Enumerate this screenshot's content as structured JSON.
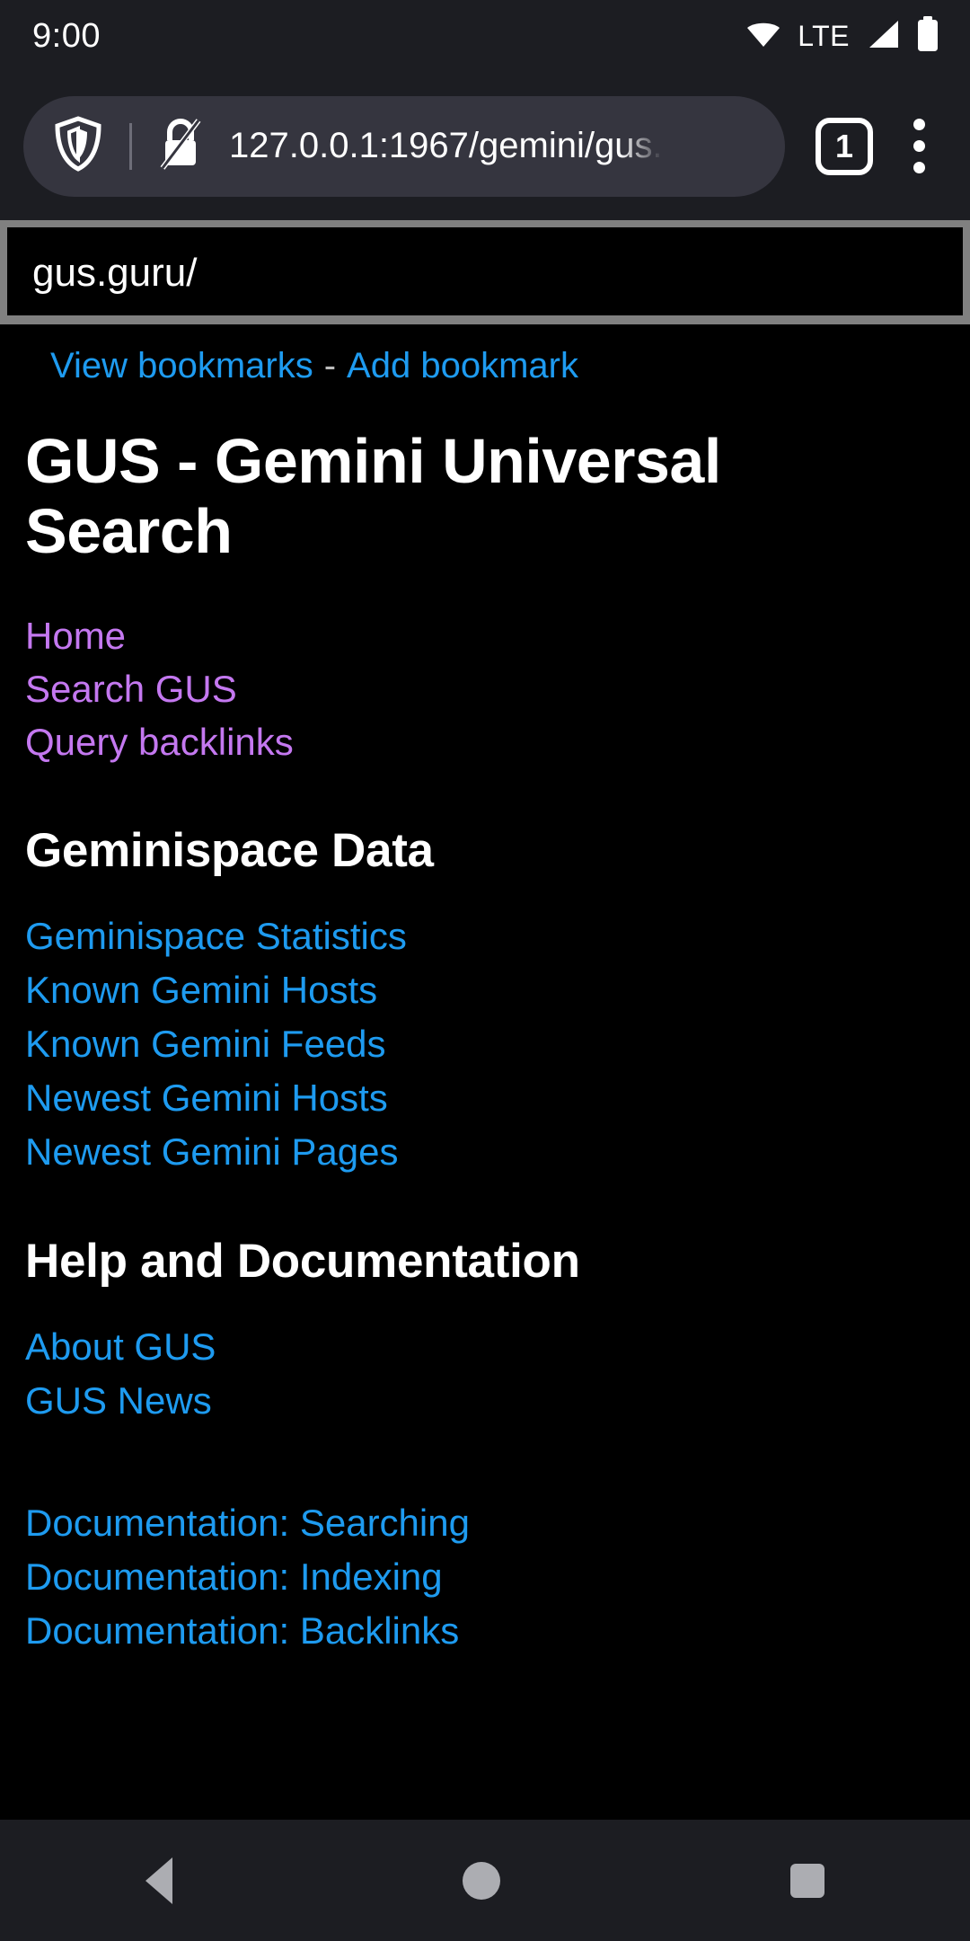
{
  "statusbar": {
    "clock": "9:00",
    "network_label": "LTE",
    "icons": [
      "wifi-icon",
      "lte-label",
      "cellular-signal-icon",
      "battery-icon"
    ]
  },
  "toolbar": {
    "shield_icon": "brave-shield-icon",
    "security_icon": "insecure-connection-icon",
    "url": "127.0.0.1:1967/gemini/gus.",
    "tab_count": "1",
    "menu_icon": "three-dot-menu-icon"
  },
  "addressbar": {
    "value": "gus.guru/",
    "placeholder": "gus.guru/"
  },
  "bookmarks": {
    "view_label": "View bookmarks",
    "separator": "-",
    "add_label": "Add bookmark"
  },
  "page": {
    "title": "GUS - Gemini Universal Search",
    "nav_links": [
      {
        "label": "Home"
      },
      {
        "label": "Search GUS"
      },
      {
        "label": "Query backlinks"
      }
    ],
    "sections": [
      {
        "heading": "Geminispace Data",
        "links": [
          {
            "label": "Geminispace Statistics"
          },
          {
            "label": "Known Gemini Hosts"
          },
          {
            "label": "Known Gemini Feeds"
          },
          {
            "label": "Newest Gemini Hosts"
          },
          {
            "label": "Newest Gemini Pages"
          }
        ]
      },
      {
        "heading": "Help and Documentation",
        "links": [
          {
            "label": "About GUS"
          },
          {
            "label": "GUS News"
          }
        ],
        "links2": [
          {
            "label": "Documentation: Searching"
          },
          {
            "label": "Documentation: Indexing"
          },
          {
            "label": "Documentation: Backlinks"
          }
        ]
      }
    ]
  },
  "navbar": {
    "back": "back-button",
    "home": "home-button",
    "recents": "recents-button"
  },
  "colors": {
    "link_blue": "#1E9BF0",
    "link_purple": "#C478F0",
    "chrome_bg": "#1C1D22",
    "pill_bg": "#35353F",
    "page_bg": "#000000"
  }
}
